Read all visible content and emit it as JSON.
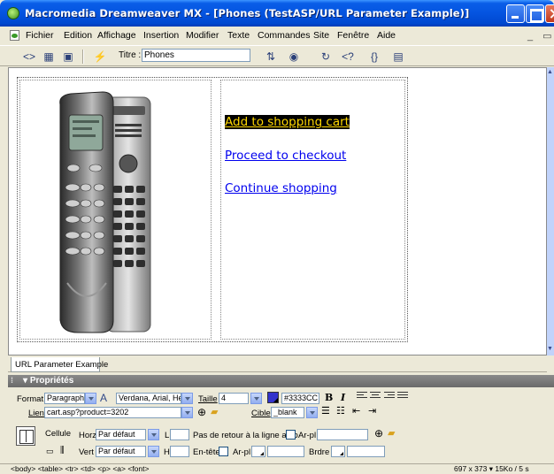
{
  "window": {
    "title": "Macromedia Dreamweaver MX - [Phones (TestASP/URL Parameter Example)]"
  },
  "menu": {
    "items": [
      "Fichier",
      "Edition",
      "Affichage",
      "Insertion",
      "Modifier",
      "Texte",
      "Commandes",
      "Site",
      "Fenêtre",
      "Aide"
    ],
    "mdi_buttons": "_ ▭"
  },
  "toolbar": {
    "title_label": "Titre :",
    "title_value": "Phones",
    "icons": [
      "code-view-icon",
      "split-view-icon",
      "design-view-icon",
      "live-data-icon",
      "file-management-icon",
      "preview-icon",
      "refresh-icon",
      "code-nav-icon",
      "braces-icon",
      "view-options-icon"
    ]
  },
  "document": {
    "links": [
      "Add to shopping cart",
      "Proceed to checkout",
      "Continue shopping"
    ],
    "selected_link_index": 0
  },
  "doc_tab": {
    "label": "URL Parameter Example"
  },
  "properties": {
    "header": "Propriétés",
    "format_label": "Format",
    "format_value": "Paragraphe",
    "font_value": "Verdana, Arial, Hel",
    "size_label": "Taille",
    "size_value": "4",
    "color_value": "#3333CC",
    "color_hex": "#3333cc",
    "bold": "B",
    "italic": "I",
    "link_label": "Lien",
    "link_value": "cart.asp?product=3202",
    "target_label": "Cible",
    "target_value": "_blank",
    "cell_label": "Cellule",
    "horz_label": "Horz",
    "horz_value": "Par défaut",
    "vert_label": "Vert",
    "vert_value": "Par défaut",
    "w_label": "L",
    "h_label": "H",
    "nowrap_label": "Pas de retour à la ligne auto",
    "header_label": "En-tête",
    "bg_label": "Ar-pl",
    "bg2_label": "Ar-pl",
    "border_label": "Brdre"
  },
  "statusbar": {
    "tag_selector": "<body> <table> <tr> <td> <p> <a> <font>",
    "dimensions": "697 x 373",
    "download": "15Ko / 5 s"
  }
}
